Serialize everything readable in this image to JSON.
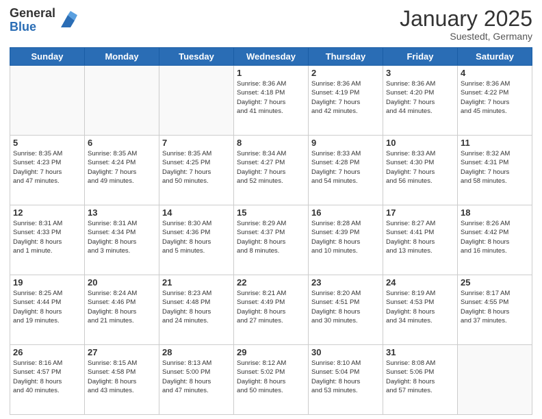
{
  "header": {
    "logo_general": "General",
    "logo_blue": "Blue",
    "month_title": "January 2025",
    "location": "Suestedt, Germany"
  },
  "days_of_week": [
    "Sunday",
    "Monday",
    "Tuesday",
    "Wednesday",
    "Thursday",
    "Friday",
    "Saturday"
  ],
  "weeks": [
    [
      {
        "day": "",
        "info": ""
      },
      {
        "day": "",
        "info": ""
      },
      {
        "day": "",
        "info": ""
      },
      {
        "day": "1",
        "info": "Sunrise: 8:36 AM\nSunset: 4:18 PM\nDaylight: 7 hours\nand 41 minutes."
      },
      {
        "day": "2",
        "info": "Sunrise: 8:36 AM\nSunset: 4:19 PM\nDaylight: 7 hours\nand 42 minutes."
      },
      {
        "day": "3",
        "info": "Sunrise: 8:36 AM\nSunset: 4:20 PM\nDaylight: 7 hours\nand 44 minutes."
      },
      {
        "day": "4",
        "info": "Sunrise: 8:36 AM\nSunset: 4:22 PM\nDaylight: 7 hours\nand 45 minutes."
      }
    ],
    [
      {
        "day": "5",
        "info": "Sunrise: 8:35 AM\nSunset: 4:23 PM\nDaylight: 7 hours\nand 47 minutes."
      },
      {
        "day": "6",
        "info": "Sunrise: 8:35 AM\nSunset: 4:24 PM\nDaylight: 7 hours\nand 49 minutes."
      },
      {
        "day": "7",
        "info": "Sunrise: 8:35 AM\nSunset: 4:25 PM\nDaylight: 7 hours\nand 50 minutes."
      },
      {
        "day": "8",
        "info": "Sunrise: 8:34 AM\nSunset: 4:27 PM\nDaylight: 7 hours\nand 52 minutes."
      },
      {
        "day": "9",
        "info": "Sunrise: 8:33 AM\nSunset: 4:28 PM\nDaylight: 7 hours\nand 54 minutes."
      },
      {
        "day": "10",
        "info": "Sunrise: 8:33 AM\nSunset: 4:30 PM\nDaylight: 7 hours\nand 56 minutes."
      },
      {
        "day": "11",
        "info": "Sunrise: 8:32 AM\nSunset: 4:31 PM\nDaylight: 7 hours\nand 58 minutes."
      }
    ],
    [
      {
        "day": "12",
        "info": "Sunrise: 8:31 AM\nSunset: 4:33 PM\nDaylight: 8 hours\nand 1 minute."
      },
      {
        "day": "13",
        "info": "Sunrise: 8:31 AM\nSunset: 4:34 PM\nDaylight: 8 hours\nand 3 minutes."
      },
      {
        "day": "14",
        "info": "Sunrise: 8:30 AM\nSunset: 4:36 PM\nDaylight: 8 hours\nand 5 minutes."
      },
      {
        "day": "15",
        "info": "Sunrise: 8:29 AM\nSunset: 4:37 PM\nDaylight: 8 hours\nand 8 minutes."
      },
      {
        "day": "16",
        "info": "Sunrise: 8:28 AM\nSunset: 4:39 PM\nDaylight: 8 hours\nand 10 minutes."
      },
      {
        "day": "17",
        "info": "Sunrise: 8:27 AM\nSunset: 4:41 PM\nDaylight: 8 hours\nand 13 minutes."
      },
      {
        "day": "18",
        "info": "Sunrise: 8:26 AM\nSunset: 4:42 PM\nDaylight: 8 hours\nand 16 minutes."
      }
    ],
    [
      {
        "day": "19",
        "info": "Sunrise: 8:25 AM\nSunset: 4:44 PM\nDaylight: 8 hours\nand 19 minutes."
      },
      {
        "day": "20",
        "info": "Sunrise: 8:24 AM\nSunset: 4:46 PM\nDaylight: 8 hours\nand 21 minutes."
      },
      {
        "day": "21",
        "info": "Sunrise: 8:23 AM\nSunset: 4:48 PM\nDaylight: 8 hours\nand 24 minutes."
      },
      {
        "day": "22",
        "info": "Sunrise: 8:21 AM\nSunset: 4:49 PM\nDaylight: 8 hours\nand 27 minutes."
      },
      {
        "day": "23",
        "info": "Sunrise: 8:20 AM\nSunset: 4:51 PM\nDaylight: 8 hours\nand 30 minutes."
      },
      {
        "day": "24",
        "info": "Sunrise: 8:19 AM\nSunset: 4:53 PM\nDaylight: 8 hours\nand 34 minutes."
      },
      {
        "day": "25",
        "info": "Sunrise: 8:17 AM\nSunset: 4:55 PM\nDaylight: 8 hours\nand 37 minutes."
      }
    ],
    [
      {
        "day": "26",
        "info": "Sunrise: 8:16 AM\nSunset: 4:57 PM\nDaylight: 8 hours\nand 40 minutes."
      },
      {
        "day": "27",
        "info": "Sunrise: 8:15 AM\nSunset: 4:58 PM\nDaylight: 8 hours\nand 43 minutes."
      },
      {
        "day": "28",
        "info": "Sunrise: 8:13 AM\nSunset: 5:00 PM\nDaylight: 8 hours\nand 47 minutes."
      },
      {
        "day": "29",
        "info": "Sunrise: 8:12 AM\nSunset: 5:02 PM\nDaylight: 8 hours\nand 50 minutes."
      },
      {
        "day": "30",
        "info": "Sunrise: 8:10 AM\nSunset: 5:04 PM\nDaylight: 8 hours\nand 53 minutes."
      },
      {
        "day": "31",
        "info": "Sunrise: 8:08 AM\nSunset: 5:06 PM\nDaylight: 8 hours\nand 57 minutes."
      },
      {
        "day": "",
        "info": ""
      }
    ]
  ]
}
